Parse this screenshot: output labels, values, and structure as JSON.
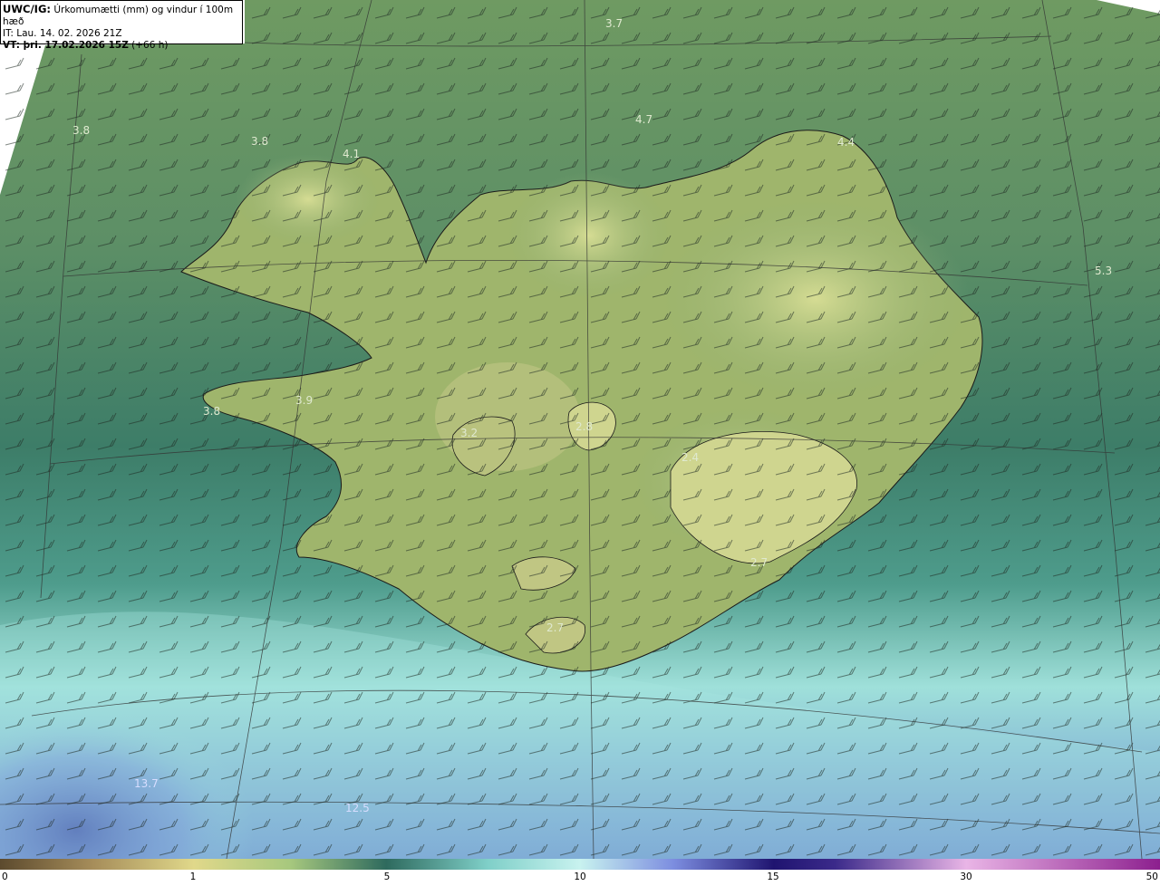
{
  "info": {
    "model": "UWC/IG:",
    "description": "Úrkomumætti (mm) og vindur í 100m hæð",
    "initial_time": "IT: Lau. 14. 02. 2026 21Z",
    "valid_time": "VT: þri. 17.02.2026 15Z",
    "lead": "(+66 h)"
  },
  "colorbar": {
    "ticks": [
      "0",
      "1",
      "5",
      "10",
      "15",
      "30",
      "50"
    ],
    "colors": [
      "#5c4a2e",
      "#a68d5a",
      "#e0d88a",
      "#a7c87e",
      "#5e9a72",
      "#2e6a5e",
      "#7fcfc8",
      "#c8f2ef",
      "#7d8ee0",
      "#3a3aa8",
      "#1f1470",
      "#e9b5e6",
      "#c85ac0",
      "#8c1f8e"
    ]
  },
  "map_values": [
    {
      "name": "label-3-7-north",
      "text": "3.7"
    },
    {
      "name": "label-3-8-west",
      "text": "3.8"
    },
    {
      "name": "label-3-8-westfjords",
      "text": "3.8"
    },
    {
      "name": "label-4-1",
      "text": "4.1"
    },
    {
      "name": "label-4-7",
      "text": "4.7"
    },
    {
      "name": "label-4-4",
      "text": "4.4"
    },
    {
      "name": "label-5-3",
      "text": "5.3"
    },
    {
      "name": "label-3-8-snaefells",
      "text": "3.8"
    },
    {
      "name": "label-3-9",
      "text": "3.9"
    },
    {
      "name": "label-3-2",
      "text": "3.2"
    },
    {
      "name": "label-2-8",
      "text": "2.8"
    },
    {
      "name": "label-2-4",
      "text": "2.4"
    },
    {
      "name": "label-2-7-east",
      "text": "2.7"
    },
    {
      "name": "label-2-7-south",
      "text": "2.7"
    },
    {
      "name": "label-13-7",
      "text": "13.7"
    },
    {
      "name": "label-12-5",
      "text": "12.5"
    }
  ]
}
